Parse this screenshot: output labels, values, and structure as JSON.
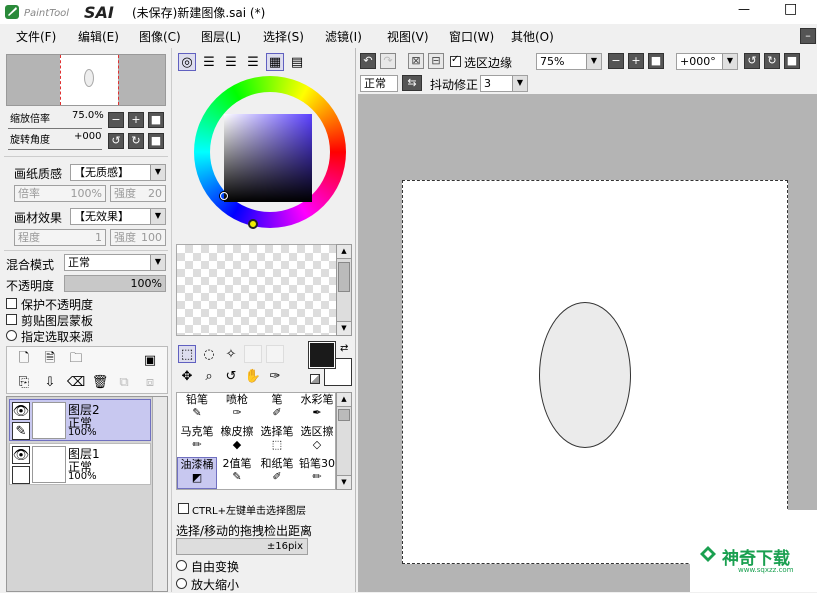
{
  "app": {
    "logo_text": "PaintTool SAI",
    "window_title": "(未保存)新建图像.sai (*)",
    "title_minimize": "—",
    "title_maximize": "□"
  },
  "menu": [
    "文件(F)",
    "编辑(E)",
    "图像(C)",
    "图层(L)",
    "选择(S)",
    "滤镜(I)",
    "视图(V)",
    "窗口(W)",
    "其他(O)"
  ],
  "navigator": {
    "zoom_label": "缩放倍率",
    "zoom_value": "75.0%",
    "rotate_label": "旋转角度",
    "rotate_value": "+000"
  },
  "paper": {
    "texture_label": "画纸质感",
    "texture_value": "【无质感】",
    "rate_label": "倍率",
    "rate_value": "100%",
    "strength_label": "强度",
    "strength_value": "20",
    "effect_label": "画材效果",
    "effect_value": "【无效果】",
    "degree_label": "程度",
    "degree_value": "1",
    "strength2_label": "强度",
    "strength2_value": "100"
  },
  "layer_opts": {
    "blend_label": "混合模式",
    "blend_value": "正常",
    "opacity_label": "不透明度",
    "opacity_value": "100%",
    "protect_opacity": "保护不透明度",
    "clip_mask": "剪贴图层蒙板",
    "select_source": "指定选取来源"
  },
  "layers": [
    {
      "name": "图层2",
      "mode": "正常",
      "opacity": "100%",
      "selected": true
    },
    {
      "name": "图层1",
      "mode": "正常",
      "opacity": "100%",
      "selected": false
    }
  ],
  "tools": [
    {
      "name": "铅笔",
      "selected": false
    },
    {
      "name": "喷枪",
      "selected": false
    },
    {
      "name": "笔",
      "selected": false
    },
    {
      "name": "水彩笔",
      "selected": false
    },
    {
      "name": "马克笔",
      "selected": false
    },
    {
      "name": "橡皮擦",
      "selected": false
    },
    {
      "name": "选择笔",
      "selected": false
    },
    {
      "name": "选区擦",
      "selected": false
    },
    {
      "name": "油漆桶",
      "selected": true
    },
    {
      "name": "2值笔",
      "selected": false
    },
    {
      "name": "和纸笔",
      "selected": false
    },
    {
      "name": "铅笔30",
      "selected": false
    }
  ],
  "tool_opts": {
    "ctrl_select": "CTRL+左键单击选择图层",
    "drag_label": "选择/移动的拖拽检出距离",
    "drag_value": "±16pix",
    "free_transform": "自由变换",
    "scale": "放大缩小"
  },
  "canvas_toolbar": {
    "selection_edge": "选区边缘",
    "zoom_value": "75%",
    "rotate_value": "+000°",
    "blend_value": "正常",
    "stabilizer_label": "抖动修正",
    "stabilizer_value": "3"
  },
  "watermark": {
    "text": "神奇下载",
    "url": "www.sqxzz.com"
  },
  "colors": {
    "primary": "#1a1a1a",
    "secondary": "#ffffff",
    "selection": "#c8c8f0",
    "canvas_bg": "#b4b4b4",
    "brand_green": "#1aa050"
  }
}
